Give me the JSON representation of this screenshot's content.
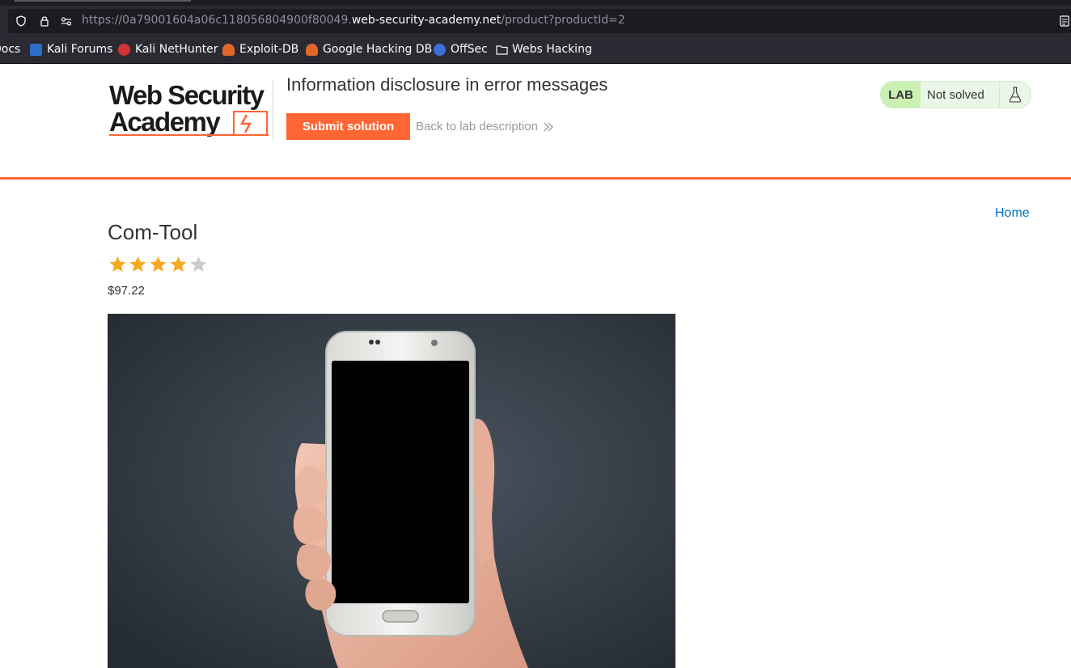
{
  "browser": {
    "url_prefix": "https://0a79001604a06c118056804900f80049.",
    "url_host": "web-security-academy.net",
    "url_path": "/product?productId=2"
  },
  "bookmarks": [
    {
      "label": "Docs",
      "icon": "docs-icon"
    },
    {
      "label": "Kali Forums",
      "icon": "kali-forums-icon"
    },
    {
      "label": "Kali NetHunter",
      "icon": "kali-nethunter-icon"
    },
    {
      "label": "Exploit-DB",
      "icon": "exploit-db-icon"
    },
    {
      "label": "Google Hacking DB",
      "icon": "ghdb-icon"
    },
    {
      "label": "OffSec",
      "icon": "offsec-icon"
    },
    {
      "label": "Webs Hacking",
      "icon": "folder-icon"
    }
  ],
  "header": {
    "logo_line1": "Web Security",
    "logo_line2": "Academy",
    "lab_title": "Information disclosure in error messages",
    "submit_label": "Submit solution",
    "back_label": "Back to lab description",
    "lab_tag": "LAB",
    "lab_status": "Not solved"
  },
  "nav": {
    "home_label": "Home"
  },
  "product": {
    "title": "Com-Tool",
    "rating": 4,
    "rating_max": 5,
    "price": "$97.22"
  },
  "colors": {
    "accent": "#ff6633",
    "link": "#0071bc",
    "star_filled": "#f7a823",
    "star_empty": "#cccccc"
  }
}
